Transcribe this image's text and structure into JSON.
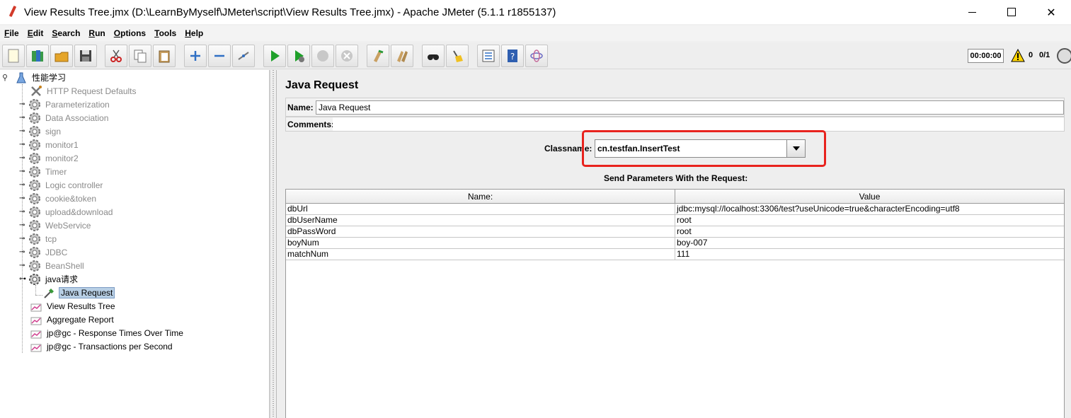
{
  "window": {
    "title": "View Results Tree.jmx (D:\\LearnByMyself\\JMeter\\script\\View Results Tree.jmx) - Apache JMeter (5.1.1 r1855137)"
  },
  "menu": [
    "File",
    "Edit",
    "Search",
    "Run",
    "Options",
    "Tools",
    "Help"
  ],
  "toolbar": {
    "buttons": [
      "new-icon",
      "templates-icon",
      "open-icon",
      "save-icon",
      "cut-icon",
      "copy-icon",
      "paste-icon",
      "expand-icon",
      "collapse-icon",
      "toggle-icon",
      "start-icon",
      "start-no-pause-icon",
      "stop-icon",
      "shutdown-icon",
      "clear-icon",
      "clear-all-icon",
      "search-icon",
      "reset-search-icon",
      "function-helper-icon",
      "help-icon",
      "remote-icon"
    ],
    "timer": "00:00:00",
    "warning_count": "0",
    "threads": "0/1"
  },
  "tree": {
    "root": "性能学习",
    "items": [
      {
        "label": "HTTP Request Defaults",
        "disabled": true
      },
      {
        "label": "Parameterization",
        "disabled": true
      },
      {
        "label": "Data Association",
        "disabled": true
      },
      {
        "label": "sign",
        "disabled": true
      },
      {
        "label": "monitor1",
        "disabled": true
      },
      {
        "label": "monitor2",
        "disabled": true
      },
      {
        "label": "Timer",
        "disabled": true
      },
      {
        "label": "Logic controller",
        "disabled": true
      },
      {
        "label": "cookie&token",
        "disabled": true
      },
      {
        "label": "upload&download",
        "disabled": true
      },
      {
        "label": "WebService",
        "disabled": true
      },
      {
        "label": "tcp",
        "disabled": true
      },
      {
        "label": "JDBC",
        "disabled": true
      },
      {
        "label": "BeanShell",
        "disabled": true
      },
      {
        "label": "java请求",
        "disabled": false
      },
      {
        "label": "Java Request",
        "disabled": false,
        "selected": true
      },
      {
        "label": "View Results Tree",
        "disabled": false
      },
      {
        "label": "Aggregate Report",
        "disabled": false
      },
      {
        "label": "jp@gc - Response Times Over Time",
        "disabled": false
      },
      {
        "label": "jp@gc - Transactions per Second",
        "disabled": false
      }
    ]
  },
  "panel": {
    "title": "Java Request",
    "name_label": "Name:",
    "name_value": "Java Request",
    "comments_label": "Comments:",
    "classname_label": "Classname:",
    "classname_value": "cn.testfan.InsertTest",
    "params_title": "Send Parameters With the Request:",
    "columns": [
      "Name:",
      "Value"
    ],
    "rows": [
      [
        "dbUrl",
        "jdbc:mysql://localhost:3306/test?useUnicode=true&characterEncoding=utf8"
      ],
      [
        "dbUserName",
        "root"
      ],
      [
        "dbPassWord",
        "root"
      ],
      [
        "boyNum",
        "boy-007"
      ],
      [
        "matchNum",
        "111"
      ]
    ]
  },
  "colors": {
    "highlight": "#e8231e",
    "selection": "#b8cfe5",
    "disabled_text": "#8a8a8a"
  }
}
